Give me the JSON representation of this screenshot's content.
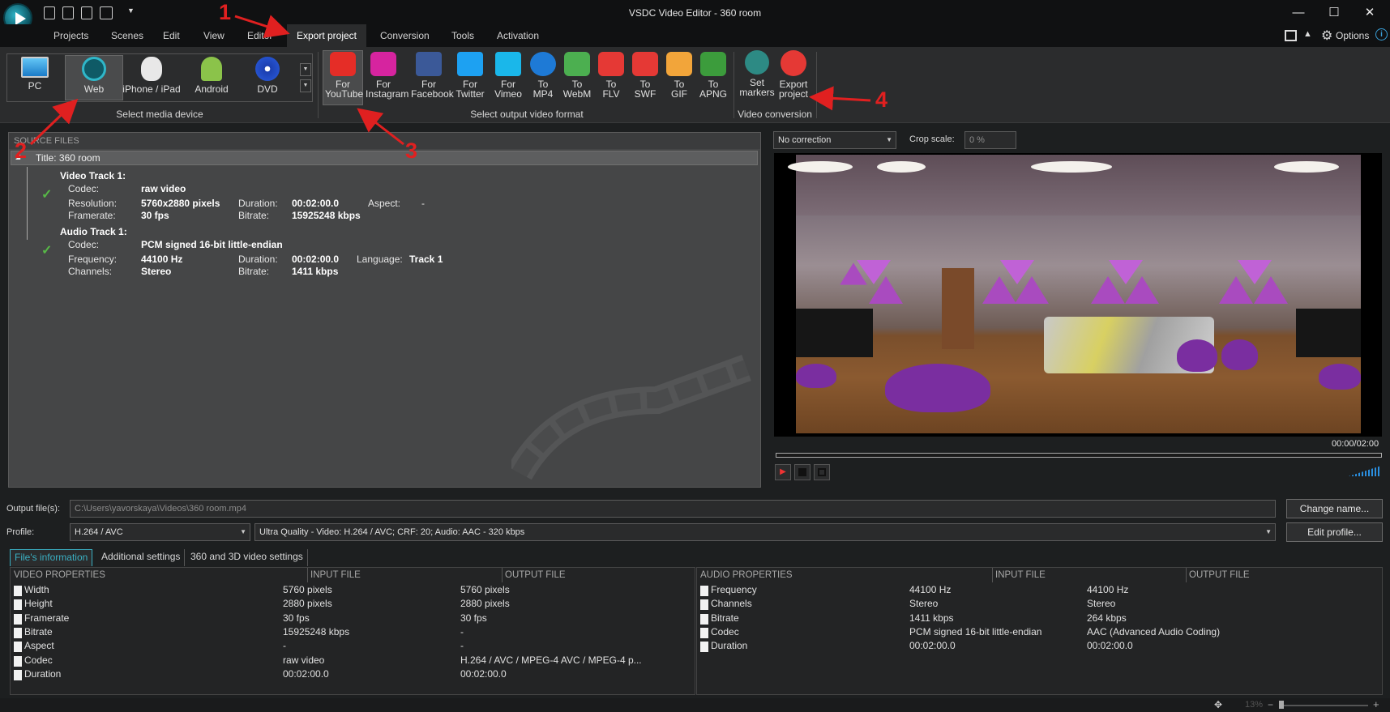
{
  "window": {
    "title": "VSDC Video Editor - 360 room",
    "minimize": "—",
    "maximize": "☐",
    "close": "✕"
  },
  "menu": {
    "items": [
      "Projects",
      "Scenes",
      "Edit",
      "View",
      "Editor",
      "Export project",
      "Conversion",
      "Tools",
      "Activation"
    ],
    "active": "Export project",
    "options": "Options"
  },
  "ribbon": {
    "devices": [
      "PC",
      "Web",
      "iPhone / iPad",
      "Android",
      "DVD"
    ],
    "device_selected": "Web",
    "device_group_label": "Select media device",
    "formats": [
      {
        "l1": "For",
        "l2": "YouTube",
        "icon": "youtube-icon"
      },
      {
        "l1": "For",
        "l2": "Instagram",
        "icon": "instagram-icon"
      },
      {
        "l1": "For",
        "l2": "Facebook",
        "icon": "facebook-icon"
      },
      {
        "l1": "For",
        "l2": "Twitter",
        "icon": "twitter-icon"
      },
      {
        "l1": "For",
        "l2": "Vimeo",
        "icon": "vimeo-icon"
      },
      {
        "l1": "To",
        "l2": "MP4",
        "icon": "quicktime-icon"
      },
      {
        "l1": "To",
        "l2": "WebM",
        "icon": "webm-icon"
      },
      {
        "l1": "To",
        "l2": "FLV",
        "icon": "flv-icon"
      },
      {
        "l1": "To",
        "l2": "SWF",
        "icon": "flash-icon"
      },
      {
        "l1": "To",
        "l2": "GIF",
        "icon": "gif-icon"
      },
      {
        "l1": "To",
        "l2": "APNG",
        "icon": "apng-icon"
      }
    ],
    "format_group_label": "Select output video format",
    "conversion": [
      {
        "l1": "Set",
        "l2": "markers"
      },
      {
        "l1": "Export",
        "l2": "project"
      }
    ],
    "conversion_group_label": "Video conversion"
  },
  "source": {
    "header": "SOURCE FILES",
    "title_row": "Title: 360 room",
    "video_track": {
      "name": "Video Track 1:",
      "codec_l": "Codec:",
      "codec": "raw video",
      "res_l": "Resolution:",
      "res": "5760x2880 pixels",
      "dur_l": "Duration:",
      "dur": "00:02:00.0",
      "aspect_l": "Aspect:",
      "aspect": "-",
      "fps_l": "Framerate:",
      "fps": "30 fps",
      "br_l": "Bitrate:",
      "br": "15925248 kbps"
    },
    "audio_track": {
      "name": "Audio Track 1:",
      "codec_l": "Codec:",
      "codec": "PCM signed 16-bit little-endian",
      "freq_l": "Frequency:",
      "freq": "44100 Hz",
      "dur_l": "Duration:",
      "dur": "00:02:00.0",
      "lang_l": "Language:",
      "lang": "Track 1",
      "ch_l": "Channels:",
      "ch": "Stereo",
      "br_l": "Bitrate:",
      "br": "1411 kbps"
    }
  },
  "preview": {
    "correction": "No correction",
    "crop_label": "Crop scale:",
    "crop_value": "0 %",
    "time": "00:00/02:00"
  },
  "output": {
    "label": "Output file(s):",
    "path": "C:\\Users\\yavorskaya\\Videos\\360 room.mp4",
    "change_btn": "Change name...",
    "profile_label": "Profile:",
    "codec": "H.264 / AVC",
    "quality": "Ultra Quality - Video: H.264 / AVC; CRF: 20; Audio: AAC - 320 kbps",
    "edit_btn": "Edit profile..."
  },
  "tabs": [
    "File's information",
    "Additional settings",
    "360 and 3D video settings"
  ],
  "video_props": {
    "headers": [
      "VIDEO PROPERTIES",
      "INPUT FILE",
      "OUTPUT FILE"
    ],
    "rows": [
      [
        "Width",
        "5760 pixels",
        "5760 pixels"
      ],
      [
        "Height",
        "2880 pixels",
        "2880 pixels"
      ],
      [
        "Framerate",
        "30 fps",
        "30 fps"
      ],
      [
        "Bitrate",
        "15925248 kbps",
        "-"
      ],
      [
        "Aspect",
        "-",
        "-"
      ],
      [
        "Codec",
        "raw video",
        "H.264 / AVC / MPEG-4 AVC / MPEG-4 p..."
      ],
      [
        "Duration",
        "00:02:00.0",
        "00:02:00.0"
      ]
    ]
  },
  "audio_props": {
    "headers": [
      "AUDIO PROPERTIES",
      "INPUT FILE",
      "OUTPUT FILE"
    ],
    "rows": [
      [
        "Frequency",
        "44100 Hz",
        "44100 Hz"
      ],
      [
        "Channels",
        "Stereo",
        "Stereo"
      ],
      [
        "Bitrate",
        "1411 kbps",
        "264 kbps"
      ],
      [
        "Codec",
        "PCM signed 16-bit little-endian",
        "AAC (Advanced Audio Coding)"
      ],
      [
        "Duration",
        "00:02:00.0",
        "00:02:00.0"
      ]
    ]
  },
  "status": {
    "zoom": "13%"
  },
  "annotations": [
    "1",
    "2",
    "3",
    "4"
  ]
}
